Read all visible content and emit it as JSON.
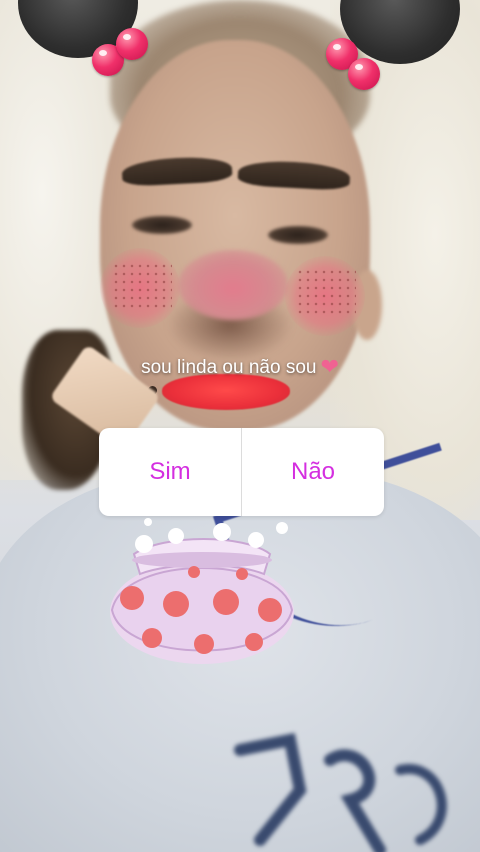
{
  "story": {
    "caption": "sou linda ou não sou",
    "caption_emoji": "❤"
  },
  "poll": {
    "option_yes": "Sim",
    "option_no": "Não",
    "option_color": "#d42fe0"
  },
  "stickers": {
    "face_filter": "bear-ears-filter",
    "bag_sticker": "polka-dot-bag-sticker"
  },
  "colors": {
    "poll_text": "#d42fe0",
    "heart": "#f06292"
  }
}
